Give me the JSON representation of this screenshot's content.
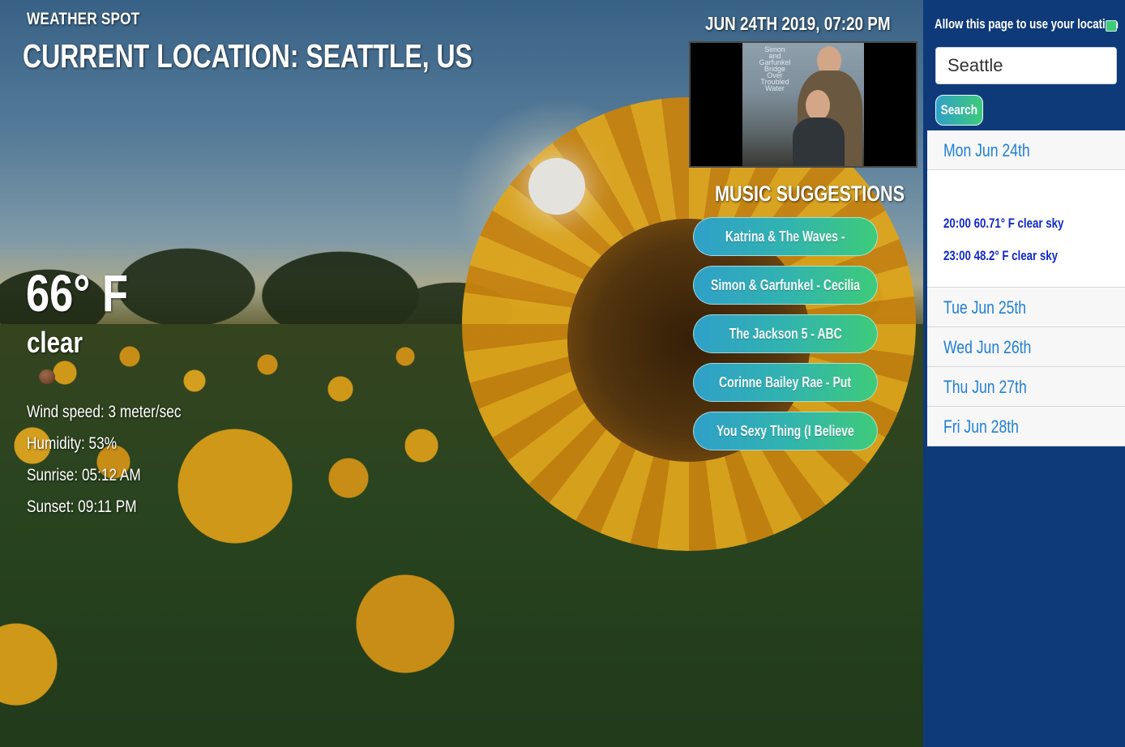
{
  "header": {
    "brand": "WEATHER SPOT",
    "location": "CURRENT LOCATION: SEATTLE, US",
    "datetime": "JUN 24TH 2019, 07:20 PM"
  },
  "current": {
    "temperature": "66° F",
    "description": "clear",
    "icon": "weather-cloud-icon",
    "wind": "Wind speed: 3 meter/sec",
    "humidity": "Humidity: 53%",
    "sunrise": "Sunrise: 05:12 AM",
    "sunset": "Sunset: 09:11 PM"
  },
  "album": {
    "text_lines": [
      "Simon",
      "and",
      "Garfunkel",
      "Bridge",
      "Over",
      "Troubled",
      "Water"
    ]
  },
  "music": {
    "title": "MUSIC SUGGESTIONS",
    "suggestions": [
      "Katrina & The Waves -",
      "Simon & Garfunkel - Cecilia",
      "The Jackson 5 - ABC",
      "Corinne Bailey Rae - Put",
      "You Sexy Thing (I Believe"
    ]
  },
  "sidebar": {
    "location_permission_label": "Allow this page to use your location",
    "location_permission_checked": true,
    "search_value": "Seattle",
    "search_button": "Search",
    "days": [
      {
        "label": "Mon Jun 24th",
        "expanded": true,
        "hours": [
          "20:00 60.71° F clear sky",
          "23:00 48.2° F clear sky"
        ]
      },
      {
        "label": "Tue Jun 25th",
        "expanded": false
      },
      {
        "label": "Wed Jun 26th",
        "expanded": false
      },
      {
        "label": "Thu Jun 27th",
        "expanded": false
      },
      {
        "label": "Fri Jun 28th",
        "expanded": false
      }
    ]
  },
  "colors": {
    "sidebar_bg": "#0f3a7a",
    "day_link": "#1f7fd1",
    "hour_text": "#1029c8",
    "button_gradient_start": "#2fa0c8",
    "button_gradient_end": "#3ecb7a"
  }
}
